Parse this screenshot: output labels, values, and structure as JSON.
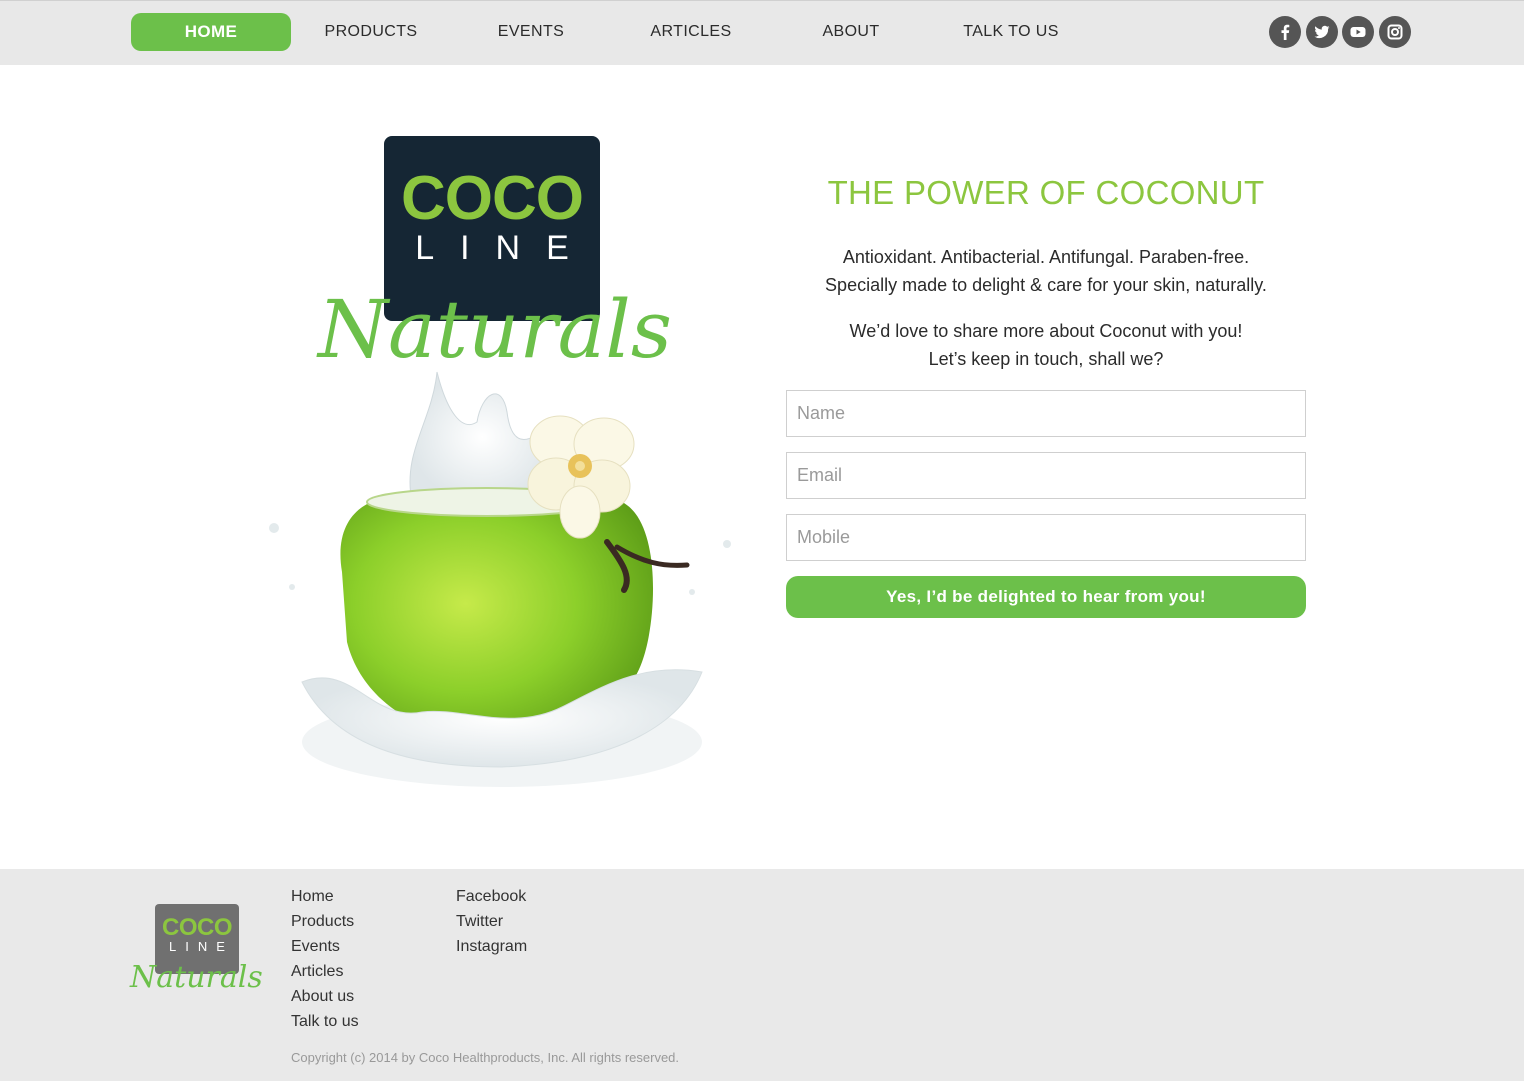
{
  "nav": {
    "items": [
      {
        "label": "HOME"
      },
      {
        "label": "PRODUCTS"
      },
      {
        "label": "EVENTS"
      },
      {
        "label": "ARTICLES"
      },
      {
        "label": "ABOUT"
      },
      {
        "label": "TALK TO US"
      }
    ],
    "active": "HOME",
    "social": [
      "facebook-icon",
      "twitter-icon",
      "youtube-icon",
      "instagram-icon"
    ]
  },
  "brand": {
    "logo_top": "COCO",
    "logo_bottom": "LINE",
    "script": "Naturals"
  },
  "hero": {
    "headline": "THE POWER OF COCONUT",
    "line1": "Antioxidant. Antibacterial. Antifungal. Paraben-free.",
    "line2": "Specially made to delight & care for your skin, naturally.",
    "line3": "We’d love to share more about Coconut with you!",
    "line4": "Let’s keep in touch, shall we?"
  },
  "form": {
    "name_placeholder": "Name",
    "email_placeholder": "Email",
    "mobile_placeholder": "Mobile",
    "submit_label": "Yes, I’d be delighted to hear from you!"
  },
  "footer": {
    "site_links": [
      "Home",
      "Products",
      "Events",
      "Articles",
      "About us",
      "Talk to us"
    ],
    "social_links": [
      "Facebook",
      "Twitter",
      "Instagram"
    ],
    "copyright": "Copyright (c) 2014 by Coco Healthproducts, Inc. All rights reserved."
  },
  "colors": {
    "accent": "#6cc04a",
    "headline": "#8cc63f",
    "logo_bg": "#152634",
    "header_bg": "#e8e8e8",
    "footer_bg": "#e9e9e9"
  }
}
